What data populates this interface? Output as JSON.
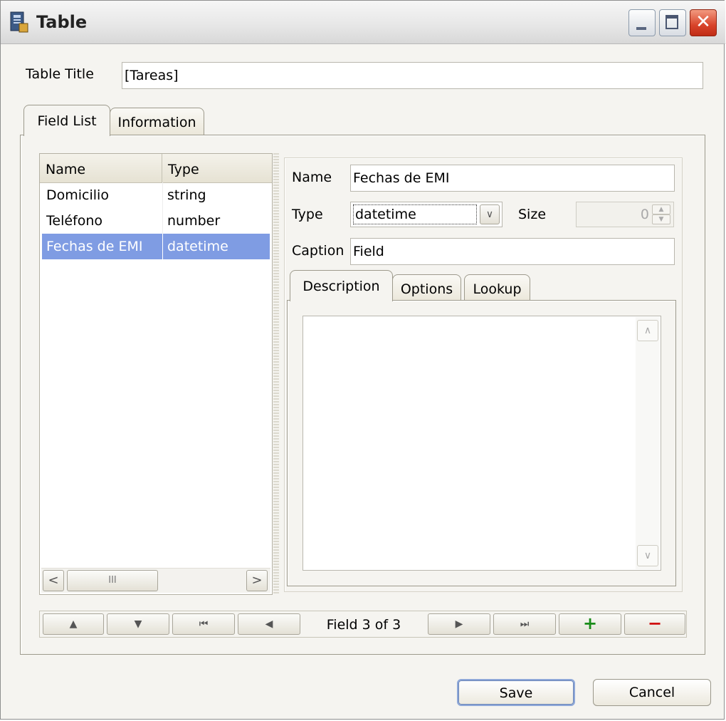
{
  "window": {
    "title": "Table"
  },
  "form": {
    "table_title_label": "Table Title",
    "table_title_value": "[Tareas]"
  },
  "main_tabs": [
    {
      "label": "Field List",
      "active": true
    },
    {
      "label": "Information",
      "active": false
    }
  ],
  "field_list": {
    "columns": [
      "Name",
      "Type"
    ],
    "rows": [
      {
        "name": "Domicilio",
        "type": "string",
        "selected": false
      },
      {
        "name": "Teléfono",
        "type": "number",
        "selected": false
      },
      {
        "name": "Fechas de EMI",
        "type": "datetime",
        "selected": true
      }
    ],
    "scroll_thumb_glyph": "III"
  },
  "detail": {
    "name_label": "Name",
    "name_value": "Fechas de EMI",
    "type_label": "Type",
    "type_value": "datetime",
    "size_label": "Size",
    "size_value": "0",
    "caption_label": "Caption",
    "caption_value": "Field",
    "tabs": [
      {
        "label": "Description",
        "active": true
      },
      {
        "label": "Options",
        "active": false
      },
      {
        "label": "Lookup",
        "active": false
      }
    ],
    "description_value": ""
  },
  "navigator": {
    "counter_text": "Field 3 of 3",
    "buttons": [
      "move-up",
      "move-down",
      "first",
      "previous",
      "next",
      "last",
      "add",
      "delete"
    ]
  },
  "dialog_buttons": {
    "save": "Save",
    "cancel": "Cancel"
  },
  "colors": {
    "selection": "#7f9ce3",
    "add": "#1a8c1a",
    "delete": "#d01010",
    "close_button": "#d8432a"
  }
}
